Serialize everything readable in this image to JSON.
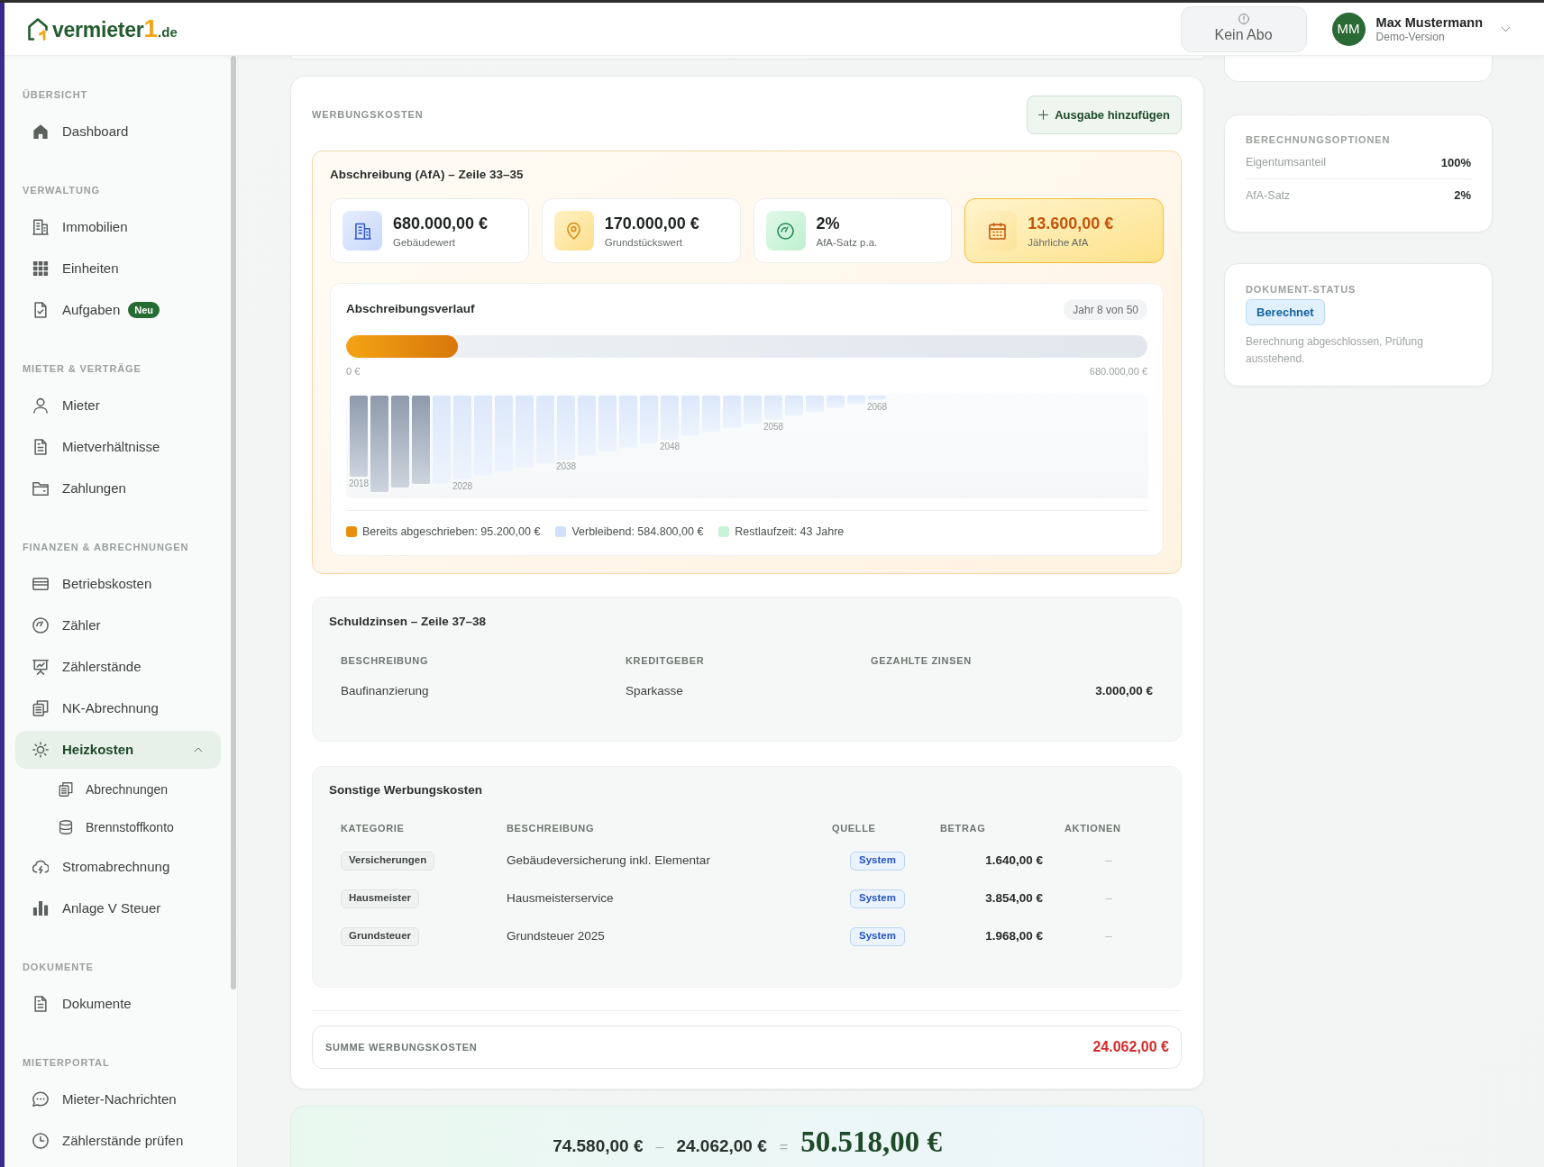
{
  "header": {
    "logo": {
      "name": "vermieter",
      "number": "1",
      "domain": ".de"
    },
    "plan_status": "Kein Abo",
    "user": {
      "initials": "MM",
      "name": "Max Mustermann",
      "subtitle": "Demo-Version"
    }
  },
  "sidebar": {
    "sections": [
      {
        "title": "ÜBERSICHT",
        "items": [
          {
            "label": "Dashboard",
            "selected": false
          }
        ]
      },
      {
        "title": "VERWALTUNG",
        "items": [
          {
            "label": "Immobilien",
            "selected": false
          },
          {
            "label": "Einheiten",
            "selected": false
          },
          {
            "label": "Aufgaben",
            "selected": false,
            "badge": "Neu"
          }
        ]
      },
      {
        "title": "MIETER & VERTRÄGE",
        "items": [
          {
            "label": "Mieter",
            "selected": false
          },
          {
            "label": "Mietverhältnisse",
            "selected": false
          },
          {
            "label": "Zahlungen",
            "selected": false
          }
        ]
      },
      {
        "title": "FINANZEN & ABRECHNUNGEN",
        "items": [
          {
            "label": "Betriebskosten",
            "selected": false
          },
          {
            "label": "Zähler",
            "selected": false
          },
          {
            "label": "Zählerstände",
            "selected": false
          },
          {
            "label": "NK-Abrechnung",
            "selected": false
          },
          {
            "label": "Heizkosten",
            "selected": true,
            "expanded": true,
            "children": [
              {
                "label": "Abrechnungen",
                "selected": false
              },
              {
                "label": "Brennstoffkonto",
                "selected": false
              }
            ]
          },
          {
            "label": "Stromabrechnung",
            "selected": false
          },
          {
            "label": "Anlage V Steuer",
            "selected": false
          }
        ]
      },
      {
        "title": "DOKUMENTE",
        "items": [
          {
            "label": "Dokumente",
            "selected": false
          }
        ]
      },
      {
        "title": "MIETERPORTAL",
        "items": [
          {
            "label": "Mieter-Nachrichten",
            "selected": false
          },
          {
            "label": "Zählerstände prüfen",
            "selected": false
          }
        ]
      }
    ]
  },
  "werbungskosten": {
    "title": "WERBUNGSKOSTEN",
    "add_button": "Ausgabe hinzufügen",
    "afa": {
      "title": "Abschreibung (AfA) – Zeile 33–35",
      "stats": [
        {
          "value": "680.000,00 €",
          "label": "Gebäudewert",
          "highlighted": false
        },
        {
          "value": "170.000,00 €",
          "label": "Grundstückswert",
          "highlighted": false
        },
        {
          "value": "2%",
          "label": "AfA-Satz p.a.",
          "highlighted": false
        },
        {
          "value": "13.600,00 €",
          "label": "Jährliche AfA",
          "highlighted": true
        }
      ],
      "chart": {
        "title": "Abschreibungsverlauf",
        "badge": "Jahr 8 von 50",
        "level": 0.14,
        "min_label": "0 €",
        "max_label": "680.000,00 €",
        "year_labels": [
          "2018",
          "2028",
          "2038",
          "2048",
          "2058",
          "2068"
        ],
        "legend": [
          {
            "label": "Bereits abgeschrieben: 95.200,00 €",
            "color": "#e8900e"
          },
          {
            "label": "Verbleibend: 584.800,00 €",
            "color": "#cfe2fa"
          },
          {
            "label": "Restlaufzeit: 43 Jahre",
            "color": "#c8f3d6"
          }
        ]
      }
    },
    "schuldzinsen": {
      "title": "Schuldzinsen – Zeile 37–38",
      "columns": [
        "BESCHREIBUNG",
        "KREDITGEBER",
        "GEZAHLTE ZINSEN"
      ],
      "rows": [
        {
          "description": "Baufinanzierung",
          "lender": "Sparkasse",
          "interest": "3.000,00 €"
        }
      ]
    },
    "sonstige": {
      "title": "Sonstige Werbungskosten",
      "columns": [
        "KATEGORIE",
        "BESCHREIBUNG",
        "QUELLE",
        "BETRAG",
        "AKTIONEN"
      ],
      "rows": [
        {
          "category": "Versicherungen",
          "description": "Gebäudeversicherung inkl. Elementar",
          "source": "System",
          "amount": "1.640,00 €",
          "actions": "–"
        },
        {
          "category": "Hausmeister",
          "description": "Hausmeisterservice",
          "source": "System",
          "amount": "3.854,00 €",
          "actions": "–"
        },
        {
          "category": "Grundsteuer",
          "description": "Grundsteuer 2025",
          "source": "System",
          "amount": "1.968,00 €",
          "actions": "–"
        }
      ]
    },
    "sum": {
      "label": "SUMME WERBUNGSKOSTEN",
      "value": "24.062,00 €"
    }
  },
  "result": {
    "income": "74.580,00 €",
    "minus": "–",
    "costs": "24.062,00 €",
    "equals": "=",
    "total": "50.518,00 €"
  },
  "calculation_options": {
    "title": "BERECHNUNGSOPTIONEN",
    "rows": [
      {
        "label": "Eigentumsanteil",
        "value": "100%"
      },
      {
        "label": "AfA-Satz",
        "value": "2%"
      }
    ]
  },
  "document_status": {
    "title": "DOKUMENT-STATUS",
    "status": "Berechnet",
    "note": "Berechnung abgeschlossen, Prüfung ausstehend."
  }
}
